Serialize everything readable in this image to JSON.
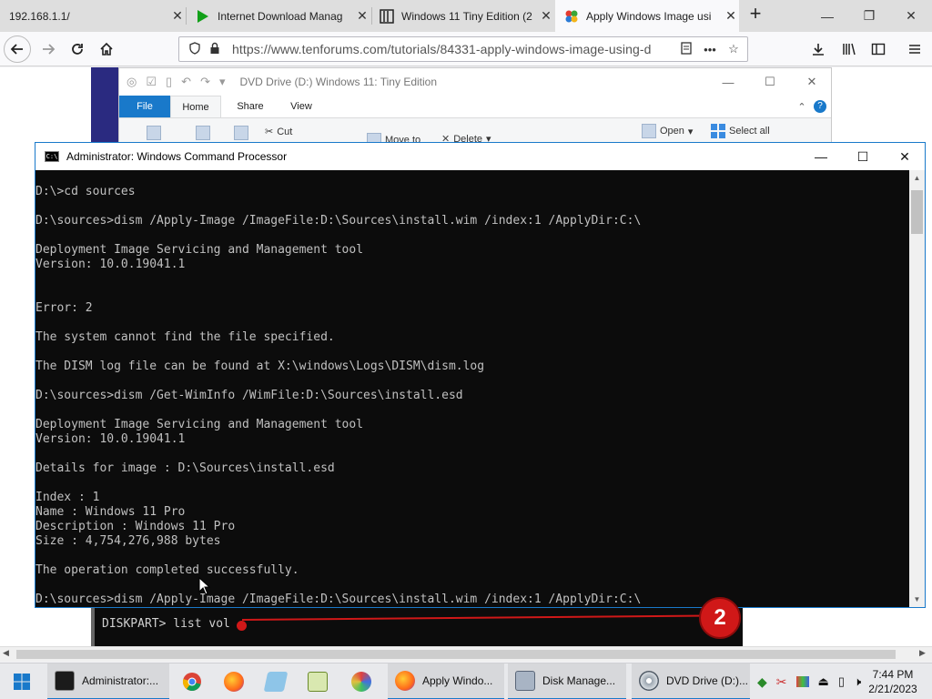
{
  "browser": {
    "tabs": [
      {
        "title": "192.168.1.1/",
        "active": false
      },
      {
        "title": "Internet Download Manag",
        "active": false
      },
      {
        "title": "Windows 11 Tiny Edition (2",
        "active": false
      },
      {
        "title": "Apply Windows Image usi",
        "active": true
      }
    ],
    "url": "https://www.tenforums.com/tutorials/84331-apply-windows-image-using-d",
    "new_tab_symbol": "+"
  },
  "explorer": {
    "title": "DVD Drive (D:) Windows 11: Tiny Edition",
    "tabs": [
      "File",
      "Home",
      "Share",
      "View"
    ],
    "ribbon": {
      "cut": "Cut",
      "move_to": "Move to",
      "delete": "Delete",
      "open": "Open",
      "select_all": "Select all"
    }
  },
  "cmd": {
    "title": "Administrator: Windows Command Processor",
    "icon_text": "C:\\",
    "lines": [
      "D:\\>cd sources",
      "",
      "D:\\sources>dism /Apply-Image /ImageFile:D:\\Sources\\install.wim /index:1 /ApplyDir:C:\\",
      "",
      "Deployment Image Servicing and Management tool",
      "Version: 10.0.19041.1",
      "",
      "",
      "Error: 2",
      "",
      "The system cannot find the file specified.",
      "",
      "The DISM log file can be found at X:\\windows\\Logs\\DISM\\dism.log",
      "",
      "D:\\sources>dism /Get-WimInfo /WimFile:D:\\Sources\\install.esd",
      "",
      "Deployment Image Servicing and Management tool",
      "Version: 10.0.19041.1",
      "",
      "Details for image : D:\\Sources\\install.esd",
      "",
      "Index : 1",
      "Name : Windows 11 Pro",
      "Description : Windows 11 Pro",
      "Size : 4,754,276,988 bytes",
      "",
      "The operation completed successfully.",
      "",
      "D:\\sources>dism /Apply-Image /ImageFile:D:\\Sources\\install.wim /index:1 /ApplyDir:C:\\"
    ]
  },
  "diskpart": {
    "line": "DISKPART> list vol",
    "badge": "2"
  },
  "taskbar": {
    "items": [
      {
        "label": "Administrator:...",
        "icon": "cmd-icon",
        "color": "#1b1b1b"
      },
      {
        "label": "Apply Windo...",
        "icon": "firefox-icon",
        "color": "#ff7b1a"
      },
      {
        "label": "Disk Manage...",
        "icon": "disk-management-icon",
        "color": "#7a8aa0"
      },
      {
        "label": "DVD Drive (D:)...",
        "icon": "dvd-drive-icon",
        "color": "#505a66"
      }
    ],
    "clock_time": "7:44 PM",
    "clock_date": "2/21/2023"
  },
  "colors": {
    "accent": "#1979ca",
    "console_bg": "#0c0c0c",
    "console_text": "#c0c0c0",
    "annotation_red": "#d01818"
  }
}
